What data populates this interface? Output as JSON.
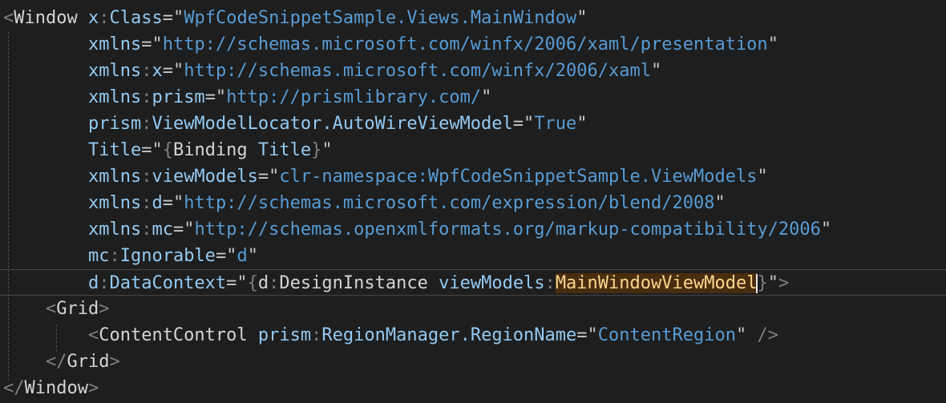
{
  "editor": {
    "language": "xaml",
    "colors": {
      "background": "#1e1e1e",
      "delimiter": "#808080",
      "element": "#d4d4d4",
      "attribute": "#92caf4",
      "string_value": "#569cd6",
      "highlight_text": "#ffd68f",
      "highlight_background": "#4a2d0e"
    },
    "lines": [
      {
        "tokens": [
          [
            "delim",
            "<"
          ],
          [
            "elem",
            "Window"
          ],
          [
            "plain",
            " "
          ],
          [
            "attr",
            "x"
          ],
          [
            "colon",
            ":"
          ],
          [
            "attr",
            "Class"
          ],
          [
            "str",
            "=\""
          ],
          [
            "sval",
            "WpfCodeSnippetSample.Views.MainWindow"
          ],
          [
            "str",
            "\""
          ]
        ]
      },
      {
        "tokens": [
          [
            "plain",
            "        "
          ],
          [
            "attr",
            "xmlns"
          ],
          [
            "str",
            "=\""
          ],
          [
            "sval",
            "http://schemas.microsoft.com/winfx/2006/xaml/presentation"
          ],
          [
            "str",
            "\""
          ]
        ]
      },
      {
        "tokens": [
          [
            "plain",
            "        "
          ],
          [
            "attr",
            "xmlns"
          ],
          [
            "colon",
            ":"
          ],
          [
            "attr",
            "x"
          ],
          [
            "str",
            "=\""
          ],
          [
            "sval",
            "http://schemas.microsoft.com/winfx/2006/xaml"
          ],
          [
            "str",
            "\""
          ]
        ]
      },
      {
        "tokens": [
          [
            "plain",
            "        "
          ],
          [
            "attr",
            "xmlns"
          ],
          [
            "colon",
            ":"
          ],
          [
            "attr",
            "prism"
          ],
          [
            "str",
            "=\""
          ],
          [
            "sval",
            "http://prismlibrary.com/"
          ],
          [
            "str",
            "\""
          ]
        ]
      },
      {
        "tokens": [
          [
            "plain",
            "        "
          ],
          [
            "attr",
            "prism"
          ],
          [
            "colon",
            ":"
          ],
          [
            "attr",
            "ViewModelLocator.AutoWireViewModel"
          ],
          [
            "str",
            "=\""
          ],
          [
            "sval",
            "True"
          ],
          [
            "str",
            "\""
          ]
        ]
      },
      {
        "tokens": [
          [
            "plain",
            "        "
          ],
          [
            "attr",
            "Title"
          ],
          [
            "str",
            "=\""
          ],
          [
            "delim",
            "{"
          ],
          [
            "bind",
            "Binding"
          ],
          [
            "plain",
            " "
          ],
          [
            "attr",
            "Title"
          ],
          [
            "delim",
            "}"
          ],
          [
            "str",
            "\""
          ]
        ]
      },
      {
        "tokens": [
          [
            "plain",
            "        "
          ],
          [
            "attr",
            "xmlns"
          ],
          [
            "colon",
            ":"
          ],
          [
            "attr",
            "viewModels"
          ],
          [
            "str",
            "=\""
          ],
          [
            "sval",
            "clr-namespace:WpfCodeSnippetSample.ViewModels"
          ],
          [
            "str",
            "\""
          ]
        ]
      },
      {
        "tokens": [
          [
            "plain",
            "        "
          ],
          [
            "attr",
            "xmlns"
          ],
          [
            "colon",
            ":"
          ],
          [
            "attr",
            "d"
          ],
          [
            "str",
            "=\""
          ],
          [
            "sval",
            "http://schemas.microsoft.com/expression/blend/2008"
          ],
          [
            "str",
            "\""
          ]
        ]
      },
      {
        "tokens": [
          [
            "plain",
            "        "
          ],
          [
            "attr",
            "xmlns"
          ],
          [
            "colon",
            ":"
          ],
          [
            "attr",
            "mc"
          ],
          [
            "str",
            "=\""
          ],
          [
            "sval",
            "http://schemas.openxmlformats.org/markup-compatibility/2006"
          ],
          [
            "str",
            "\""
          ]
        ]
      },
      {
        "tokens": [
          [
            "plain",
            "        "
          ],
          [
            "attr",
            "mc"
          ],
          [
            "colon",
            ":"
          ],
          [
            "attr",
            "Ignorable"
          ],
          [
            "str",
            "=\""
          ],
          [
            "sval",
            "d"
          ],
          [
            "str",
            "\""
          ]
        ]
      },
      {
        "current": true,
        "tokens": [
          [
            "plain",
            "        "
          ],
          [
            "attr",
            "d"
          ],
          [
            "colon",
            ":"
          ],
          [
            "attr",
            "DataContext"
          ],
          [
            "str",
            "=\""
          ],
          [
            "delim",
            "{"
          ],
          [
            "bind",
            "d"
          ],
          [
            "colon",
            ":"
          ],
          [
            "bind",
            "DesignInstance"
          ],
          [
            "plain",
            " "
          ],
          [
            "attr",
            "viewModels"
          ],
          [
            "colon",
            ":"
          ],
          [
            "hl",
            "MainWindowViewModel"
          ],
          [
            "caret",
            ""
          ],
          [
            "delim",
            "}"
          ],
          [
            "str",
            "\""
          ],
          [
            "delim",
            ">"
          ]
        ]
      },
      {
        "tokens": [
          [
            "plain",
            "    "
          ],
          [
            "delim",
            "<"
          ],
          [
            "elem",
            "Grid"
          ],
          [
            "delim",
            ">"
          ]
        ]
      },
      {
        "tokens": [
          [
            "plain",
            "        "
          ],
          [
            "delim",
            "<"
          ],
          [
            "elem",
            "ContentControl"
          ],
          [
            "plain",
            " "
          ],
          [
            "attr",
            "prism"
          ],
          [
            "colon",
            ":"
          ],
          [
            "attr",
            "RegionManager.RegionName"
          ],
          [
            "str",
            "=\""
          ],
          [
            "sval",
            "ContentRegion"
          ],
          [
            "str",
            "\""
          ],
          [
            "plain",
            " "
          ],
          [
            "delim",
            "/>"
          ]
        ]
      },
      {
        "tokens": [
          [
            "plain",
            "    "
          ],
          [
            "delim",
            "</"
          ],
          [
            "elem",
            "Grid"
          ],
          [
            "delim",
            ">"
          ]
        ]
      },
      {
        "tokens": [
          [
            "delim",
            "</"
          ],
          [
            "elem",
            "Window"
          ],
          [
            "delim",
            ">"
          ]
        ]
      }
    ]
  }
}
